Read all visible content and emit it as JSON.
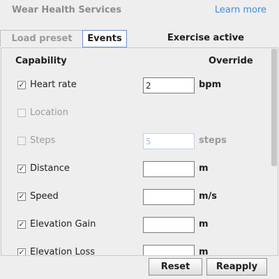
{
  "header": {
    "title": "Wear Health Services",
    "link": "Learn more"
  },
  "tabs": [
    {
      "label": "Load preset",
      "active": false
    },
    {
      "label": "Events",
      "active": true
    }
  ],
  "status": "Exercise active",
  "table": {
    "col_capability": "Capability",
    "col_override": "Override",
    "rows": [
      {
        "label": "Heart rate",
        "checked": true,
        "enabled": true,
        "value": "2",
        "unit": "bpm"
      },
      {
        "label": "Location",
        "checked": false,
        "enabled": false,
        "value": "",
        "unit": ""
      },
      {
        "label": "Steps",
        "checked": false,
        "enabled": false,
        "value": "5",
        "unit": "steps"
      },
      {
        "label": "Distance",
        "checked": true,
        "enabled": true,
        "value": "",
        "unit": "m"
      },
      {
        "label": "Speed",
        "checked": true,
        "enabled": true,
        "value": "",
        "unit": "m/s"
      },
      {
        "label": "Elevation Gain",
        "checked": true,
        "enabled": true,
        "value": "",
        "unit": "m"
      },
      {
        "label": "Elevation Loss",
        "checked": true,
        "enabled": true,
        "value": "",
        "unit": "m"
      }
    ]
  },
  "buttons": {
    "reset": "Reset",
    "reapply": "Reapply"
  },
  "colors": {
    "link": "#3d8de0",
    "disabled_text": "#9a9a9a",
    "active_tab_border": "#6b8fc9"
  }
}
